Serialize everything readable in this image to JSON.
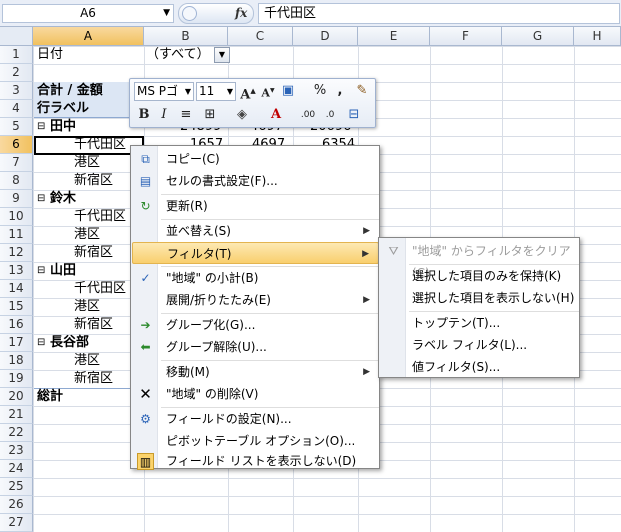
{
  "formula_bar": {
    "name_box": "A6",
    "fx_label": "fx",
    "formula": "千代田区"
  },
  "columns": [
    "A",
    "B",
    "C",
    "D",
    "E",
    "F",
    "G",
    "H"
  ],
  "rows": [
    "1",
    "2",
    "3",
    "4",
    "5",
    "6",
    "7",
    "8",
    "9",
    "10",
    "11",
    "12",
    "13",
    "14",
    "15",
    "16",
    "17",
    "18",
    "19",
    "20",
    "21",
    "22",
    "23",
    "24",
    "25",
    "26",
    "27"
  ],
  "sheet": {
    "filter_label": "日付",
    "filter_value": "（すべて）",
    "values_header": "合計 / 金額",
    "row_labels": "行ラベル",
    "tanaka": "田中",
    "tanaka_vals": [
      "24899",
      "4697",
      "20696"
    ],
    "chiyoda_row6": "千代田区",
    "row6_vals": [
      "1657",
      "4697",
      "6354"
    ],
    "minato": "港区",
    "shinjuku": "新宿区",
    "suzuki": "鈴木",
    "yamada": "山田",
    "hasebe": "長谷部",
    "total": "総計",
    "expand_icon": "⊟"
  },
  "mini_toolbar": {
    "font": "MS Pゴ",
    "size": "11"
  },
  "context_menu": [
    {
      "label": "コピー(C)",
      "icon": "copy-icon"
    },
    {
      "label": "セルの書式設定(F)...",
      "icon": "format-cells-icon"
    },
    {
      "label": "更新(R)",
      "icon": "refresh-icon"
    },
    {
      "label": "並べ替え(S)",
      "icon": "",
      "submenu": true
    },
    {
      "label": "フィルタ(T)",
      "icon": "",
      "submenu": true,
      "highlighted": true
    },
    {
      "label": "\"地域\" の小計(B)",
      "icon": "check-icon"
    },
    {
      "label": "展開/折りたたみ(E)",
      "icon": "",
      "submenu": true
    },
    {
      "label": "グループ化(G)...",
      "icon": "group-icon"
    },
    {
      "label": "グループ解除(U)...",
      "icon": "ungroup-icon"
    },
    {
      "label": "移動(M)",
      "icon": "",
      "submenu": true
    },
    {
      "label": "\"地域\" の削除(V)",
      "icon": "delete-icon"
    },
    {
      "label": "フィールドの設定(N)...",
      "icon": "field-settings-icon"
    },
    {
      "label": "ピボットテーブル オプション(O)...",
      "icon": ""
    },
    {
      "label": "フィールド リストを表示しない(D)",
      "icon": "field-list-icon"
    }
  ],
  "filter_submenu": [
    {
      "label": "\"地域\" からフィルタをクリア(C)",
      "disabled": true
    },
    {
      "label": "選択した項目のみを保持(K)"
    },
    {
      "label": "選択した項目を表示しない(H)"
    },
    {
      "label": "トップテン(T)..."
    },
    {
      "label": "ラベル フィルタ(L)..."
    },
    {
      "label": "値フィルタ(S)..."
    }
  ]
}
